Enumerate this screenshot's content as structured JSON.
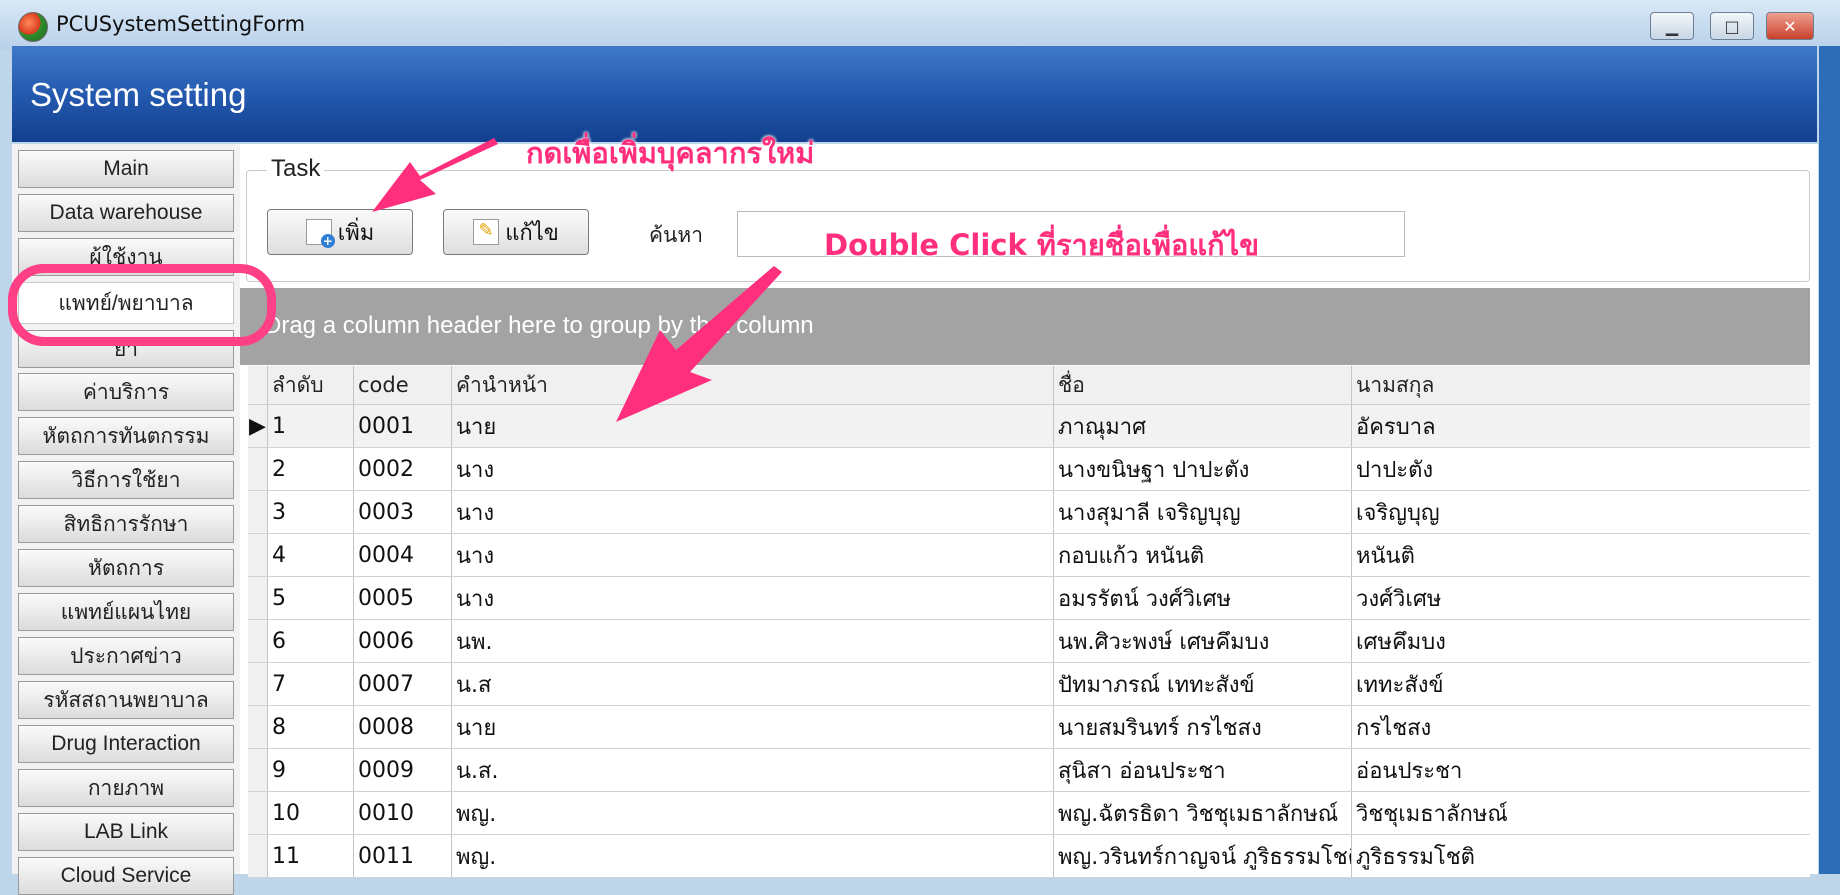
{
  "window": {
    "title": "PCUSystemSettingForm",
    "minimize": "▁",
    "maximize": "□",
    "close": "✕"
  },
  "header": {
    "title": "System setting"
  },
  "sidebar": {
    "items": [
      {
        "label": "Main"
      },
      {
        "label": "Data warehouse"
      },
      {
        "label": "ผู้ใช้งาน"
      },
      {
        "label": "แพทย์/พยาบาล"
      },
      {
        "label": "ยา"
      },
      {
        "label": "ค่าบริการ"
      },
      {
        "label": "หัตถการทันตกรรม"
      },
      {
        "label": "วิธีการใช้ยา"
      },
      {
        "label": "สิทธิการรักษา"
      },
      {
        "label": "หัตถการ"
      },
      {
        "label": "แพทย์แผนไทย"
      },
      {
        "label": "ประกาศข่าว"
      },
      {
        "label": "รหัสสถานพยาบาล"
      },
      {
        "label": "Drug Interaction"
      },
      {
        "label": "กายภาพ"
      },
      {
        "label": "LAB Link"
      },
      {
        "label": "Cloud Service"
      }
    ],
    "active_index": 3
  },
  "task": {
    "group_label": "Task",
    "add_label": "เพิ่ม",
    "edit_label": "แก้ไข",
    "search_label": "ค้นหา",
    "search_value": ""
  },
  "grid": {
    "group_hint": "Drag a column header here to group by that column",
    "columns": [
      "ลำดับ",
      "code",
      "คำนำหน้า",
      "ชื่อ",
      "นามสกุล"
    ],
    "rows": [
      {
        "seq": "1",
        "code": "0001",
        "prefix": "นาย",
        "name": "ภาณุมาศ",
        "surname": "อัครบาล"
      },
      {
        "seq": "2",
        "code": "0002",
        "prefix": "นาง",
        "name": "นางขนิษฐา ปาปะตัง",
        "surname": "ปาปะตัง"
      },
      {
        "seq": "3",
        "code": "0003",
        "prefix": "นาง",
        "name": "นางสุมาลี เจริญบุญ",
        "surname": " เจริญบุญ"
      },
      {
        "seq": "4",
        "code": "0004",
        "prefix": "นาง",
        "name": "กอบแก้ว หนันติ",
        "surname": "หนันติ"
      },
      {
        "seq": "5",
        "code": "0005",
        "prefix": "นาง",
        "name": "อมรรัตน์  วงศ์วิเศษ",
        "surname": "วงศ์วิเศษ"
      },
      {
        "seq": "6",
        "code": "0006",
        "prefix": "นพ.",
        "name": "นพ.ศิวะพงษ์ เศษคึมบง",
        "surname": "เศษคึมบง"
      },
      {
        "seq": "7",
        "code": "0007",
        "prefix": "น.ส",
        "name": "ปัทมาภรณ์ เททะสังข์",
        "surname": "เททะสังข์"
      },
      {
        "seq": "8",
        "code": "0008",
        "prefix": "นาย",
        "name": "นายสมรินทร์ กรไชสง",
        "surname": "กรไชสง"
      },
      {
        "seq": "9",
        "code": "0009",
        "prefix": "น.ส.",
        "name": "สุนิสา อ่อนประชา",
        "surname": "อ่อนประชา"
      },
      {
        "seq": "10",
        "code": "0010",
        "prefix": "พญ.",
        "name": "พญ.ฉัตรธิดา วิชชุเมธาลักษณ์",
        "surname": "วิชชุเมธาลักษณ์"
      },
      {
        "seq": "11",
        "code": "0011",
        "prefix": "พญ.",
        "name": "พญ.วรินทร์กาญจน์ ภูริธรรมโชติ",
        "surname": "ภูริธรรมโชติ"
      }
    ]
  },
  "annotations": {
    "add_hint": "กดเพื่อเพิ่มบุคลากรใหม่",
    "edit_hint": "Double Click ที่รายชื่อเพื่อแก้ไข"
  },
  "colors": {
    "accent": "#ff2f7d",
    "header_blue": "#2257ac"
  }
}
